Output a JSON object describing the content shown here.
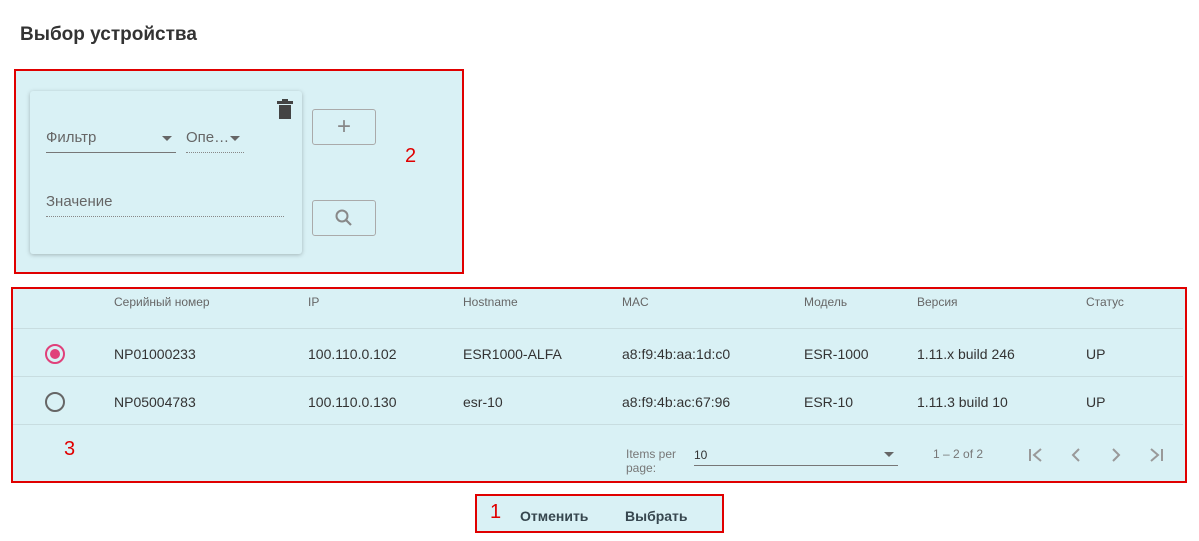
{
  "page": {
    "title": "Выбор устройства"
  },
  "filter": {
    "filter_label": "Фильтр",
    "operator_label": "Опе…",
    "value_label": "Значение"
  },
  "annotations": {
    "one": "1",
    "two": "2",
    "three": "3"
  },
  "table": {
    "columns": [
      "Серийный номер",
      "IP",
      "Hostname",
      "MAC",
      "Модель",
      "Версия",
      "Статус"
    ],
    "rows": [
      {
        "selected": true,
        "serial": "NP01000233",
        "ip": "100.110.0.102",
        "hostname": "ESR1000-ALFA",
        "mac": "a8:f9:4b:aa:1d:c0",
        "model": "ESR-1000",
        "version": "1.11.x build 246",
        "status": "UP"
      },
      {
        "selected": false,
        "serial": "NP05004783",
        "ip": "100.110.0.130",
        "hostname": "esr-10",
        "mac": "a8:f9:4b:ac:67:96",
        "model": "ESR-10",
        "version": "1.11.3 build 10",
        "status": "UP"
      }
    ]
  },
  "pagination": {
    "items_per_page_label": "Items per page:",
    "items_per_page_value": "10",
    "range_label": "1 – 2 of 2"
  },
  "actions": {
    "cancel_label": "Отменить",
    "select_label": "Выбрать"
  },
  "colors": {
    "panel_bg": "#d9f1f5",
    "annotation_red": "#e00000",
    "radio_accent": "#e0407a"
  }
}
